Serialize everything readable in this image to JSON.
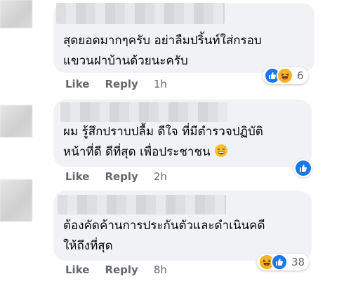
{
  "comments": [
    {
      "text_line1": "สุดยอดมากๆครับ อย่าลืมปริ้นท์ใส่กรอบ",
      "text_line2": "แขวนฝาบ้านด้วยนะครับ",
      "actions": {
        "like": "Like",
        "reply": "Reply",
        "time": "1h"
      },
      "reactions": {
        "types": [
          "like-icon",
          "haha-icon"
        ],
        "count": "6"
      }
    },
    {
      "text_line1": "ผม รู้สึกปราบปลื้ม ดีใจ ที่มีตำรวจปฏิบัติ",
      "text_line2": "หน้าที่ดี ดีที่สุด เพื่อประชาชน",
      "text_emoji": "sweat-smile-emoji",
      "actions": {
        "like": "Like",
        "reply": "Reply",
        "time": "2h"
      },
      "reactions": {
        "types": [
          "like-icon"
        ],
        "count": ""
      }
    },
    {
      "text_line1": "ต้องคัดค้านการประกันตัวและดำเนินคดี",
      "text_line2": "ให้ถึงที่สุด",
      "actions": {
        "like": "Like",
        "reply": "Reply",
        "time": "8h"
      },
      "reactions": {
        "types": [
          "haha-icon",
          "like-icon"
        ],
        "count": "38"
      }
    }
  ],
  "colors": {
    "bubble": "#f0f2f5",
    "meta": "#65676b",
    "like_blue": "#1877f2",
    "haha_yellow": "#f7b125"
  }
}
